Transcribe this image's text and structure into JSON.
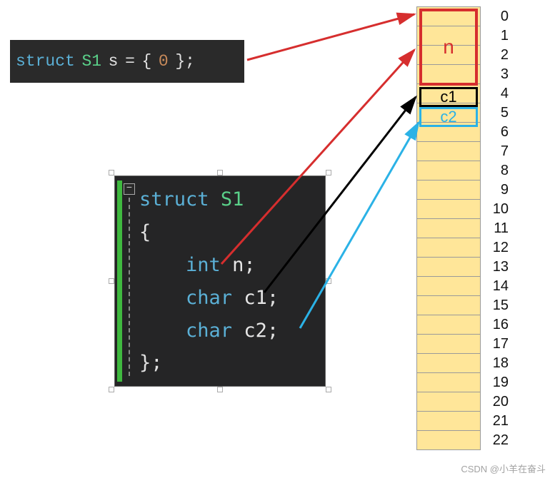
{
  "code1": {
    "kw": "struct",
    "type": "S1",
    "var": "s",
    "eq": "=",
    "open": "{",
    "val": "0",
    "close": "}",
    "semi": ";"
  },
  "code2": {
    "collapse": "−",
    "line1_kw": "struct",
    "line1_typ": "S1",
    "open": "{",
    "field1_kw": "int",
    "field1_name": "n",
    "field1_semi": ";",
    "field2_kw": "char",
    "field2_name": "c1",
    "field2_semi": ";",
    "field3_kw": "char",
    "field3_name": "c2",
    "field3_semi": ";",
    "close": "};"
  },
  "memory": {
    "rows": [
      "0",
      "1",
      "2",
      "3",
      "4",
      "5",
      "6",
      "7",
      "8",
      "9",
      "10",
      "11",
      "12",
      "13",
      "14",
      "15",
      "16",
      "17",
      "18",
      "19",
      "20",
      "21",
      "22"
    ],
    "highlight_n": "n",
    "highlight_c1": "c1",
    "highlight_c2": "c2"
  },
  "watermark": "CSDN @小羊在奋斗"
}
